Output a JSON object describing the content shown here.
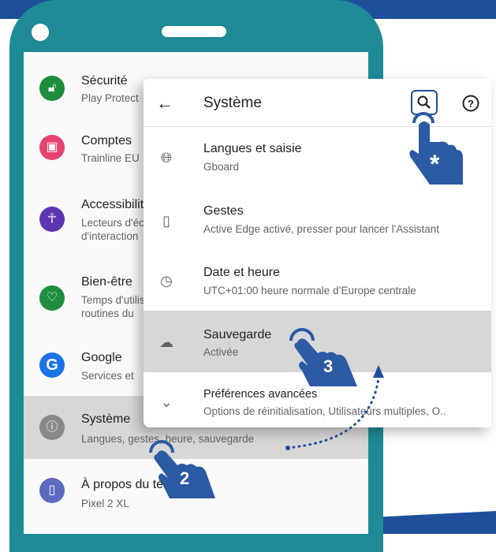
{
  "colors": {
    "brand_blue": "#1f4f9a",
    "phone_teal": "#1e8b97",
    "selection_gray": "#d7d7d7",
    "hand_blue": "#2a5ba3"
  },
  "settings_list": [
    {
      "icon": "lock-open-icon",
      "color": "#1e8e3e",
      "title": "Sécurité",
      "subtitle": "Play Protect"
    },
    {
      "icon": "account-box-icon",
      "color": "#e8426f",
      "title": "Comptes",
      "subtitle": "Trainline EU"
    },
    {
      "icon": "accessibility-icon",
      "color": "#5e35b1",
      "title": "Accessibilité",
      "subtitle": "Lecteurs d'écran",
      "subtitle2": "d'interaction"
    },
    {
      "icon": "wellbeing-icon",
      "color": "#1e8e3e",
      "title": "Bien-être",
      "subtitle": "Temps d'utilisation",
      "subtitle2": "routines du"
    },
    {
      "icon": "google-g-icon",
      "color": "#1a73e8",
      "title": "Google",
      "subtitle": "Services et"
    },
    {
      "icon": "info-icon",
      "color": "#888888",
      "title": "Système",
      "subtitle": "Langues, gestes, heure, sauvegarde",
      "selected": true
    },
    {
      "icon": "phone-info-icon",
      "color": "#5c6bc0",
      "title": "À propos du téléphone",
      "subtitle": "Pixel 2 XL"
    }
  ],
  "panel": {
    "title": "Système",
    "items": [
      {
        "icon": "globe-icon",
        "title": "Langues et saisie",
        "subtitle": "Gboard"
      },
      {
        "icon": "gesture-icon",
        "title": "Gestes",
        "subtitle": "Active Edge activé, presser pour lancer l'Assistant"
      },
      {
        "icon": "clock-icon",
        "title": "Date et heure",
        "subtitle": "UTC+01:00 heure normale d’Europe centrale"
      },
      {
        "icon": "cloud-backup-icon",
        "title": "Sauvegarde",
        "subtitle": "Activée",
        "selected": true
      },
      {
        "icon": "chevron-down-icon",
        "title": "Préférences avancées",
        "subtitle": "Options de réinitialisation, Utilisateurs multiples, O.."
      }
    ]
  },
  "steps": {
    "step_search": "*",
    "step_2": "2",
    "step_3": "3"
  }
}
